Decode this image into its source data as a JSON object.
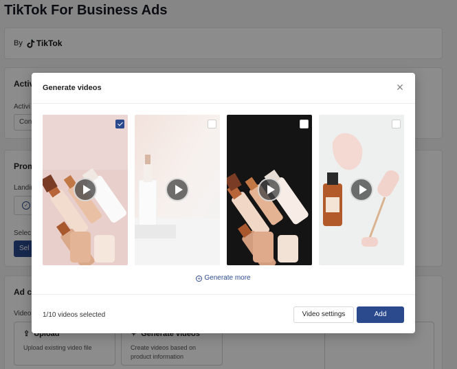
{
  "background": {
    "page_title": "TikTok For Business Ads",
    "by_label": "By",
    "brand_name": "TikTok",
    "activity_heading": "Activ",
    "activity_label": "Activi",
    "activity_input": "Con",
    "promo_heading": "Prom",
    "landing_label": "Landin",
    "select_label": "Selec",
    "select_button": "Sel",
    "ad_heading": "Ad cr",
    "video_label": "Video",
    "upload_option": {
      "title": "Upload",
      "description": "Upload existing video file",
      "icon": "upload-icon"
    },
    "generate_option": {
      "title": "Generate videos",
      "description": "Create videos based on product information",
      "icon": "sparkle-icon"
    }
  },
  "modal": {
    "title": "Generate videos",
    "close_icon": "close-icon",
    "videos": [
      {
        "id": "video-1",
        "checked": true,
        "theme": "pink-cosmetics"
      },
      {
        "id": "video-2",
        "checked": false,
        "theme": "white-dropper"
      },
      {
        "id": "video-3",
        "checked": false,
        "theme": "dark-bottles"
      },
      {
        "id": "video-4",
        "checked": false,
        "theme": "serum-roller"
      }
    ],
    "generate_more_label": "Generate more",
    "selected_count": "1/10 videos selected",
    "settings_button": "Video settings",
    "add_button": "Add"
  },
  "colors": {
    "accent": "#2b4a8e",
    "overlay": "rgba(0,0,0,0.45)"
  }
}
